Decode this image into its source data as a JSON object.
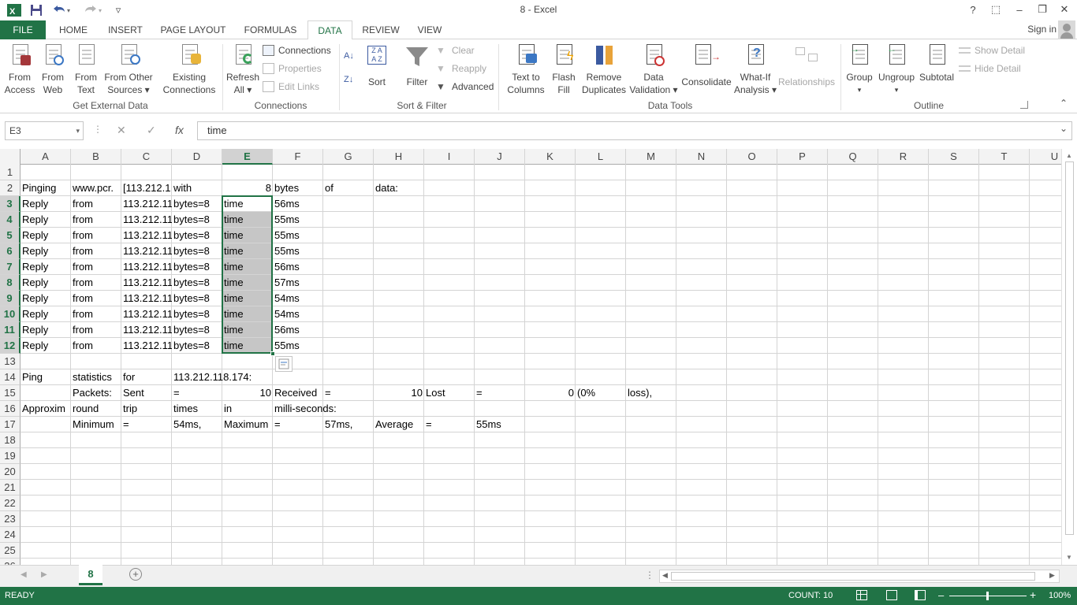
{
  "window": {
    "title": "8 - Excel",
    "help": "?",
    "minimize": "–",
    "restore": "❐",
    "close": "✕",
    "ribbon_display": "⬚"
  },
  "qat": {
    "customize": "▿"
  },
  "tabs": [
    "FILE",
    "HOME",
    "INSERT",
    "PAGE LAYOUT",
    "FORMULAS",
    "DATA",
    "REVIEW",
    "VIEW"
  ],
  "active_tab": "DATA",
  "signin": "Sign in",
  "ribbon": {
    "get_external": {
      "label": "Get External Data",
      "from_access": [
        "From",
        "Access"
      ],
      "from_web": [
        "From",
        "Web"
      ],
      "from_text": [
        "From",
        "Text"
      ],
      "from_other": [
        "From Other",
        "Sources ▾"
      ],
      "existing": [
        "Existing",
        "Connections"
      ]
    },
    "connections": {
      "label": "Connections",
      "refresh": [
        "Refresh",
        "All ▾"
      ],
      "connections": "Connections",
      "properties": "Properties",
      "edit_links": "Edit Links"
    },
    "sort_filter": {
      "label": "Sort & Filter",
      "sort": "Sort",
      "filter": "Filter",
      "clear": "Clear",
      "reapply": "Reapply",
      "advanced": "Advanced"
    },
    "data_tools": {
      "label": "Data Tools",
      "text_to_columns": [
        "Text to",
        "Columns"
      ],
      "flash_fill": [
        "Flash",
        "Fill"
      ],
      "remove_duplicates": [
        "Remove",
        "Duplicates"
      ],
      "data_validation": [
        "Data",
        "Validation ▾"
      ],
      "consolidate": "Consolidate",
      "what_if": [
        "What-If",
        "Analysis ▾"
      ],
      "relationships": "Relationships"
    },
    "outline": {
      "label": "Outline",
      "group": "Group",
      "group_dd": "▾",
      "ungroup": "Ungroup",
      "ungroup_dd": "▾",
      "subtotal": "Subtotal",
      "show_detail": "Show Detail",
      "hide_detail": "Hide Detail"
    }
  },
  "formula_bar": {
    "name_box": "E3",
    "name_box_dd": "▾",
    "cancel": "✕",
    "enter": "✓",
    "fx": "fx",
    "content": "time",
    "expand": "⌄"
  },
  "columns": [
    "A",
    "B",
    "C",
    "D",
    "E",
    "F",
    "G",
    "H",
    "I",
    "J",
    "K",
    "L",
    "M",
    "N",
    "O",
    "P",
    "Q",
    "R",
    "S",
    "T",
    "U"
  ],
  "rows": [
    "1",
    "2",
    "3",
    "4",
    "5",
    "6",
    "7",
    "8",
    "9",
    "10",
    "11",
    "12",
    "13",
    "14",
    "15",
    "16",
    "17",
    "18",
    "19",
    "20",
    "21",
    "22",
    "23",
    "24",
    "25",
    "26"
  ],
  "cells": [
    {
      "r": 2,
      "c": "A",
      "v": "Pinging"
    },
    {
      "r": 2,
      "c": "B",
      "v": "www.pcr."
    },
    {
      "r": 2,
      "c": "C",
      "v": "[113.212.1"
    },
    {
      "r": 2,
      "c": "D",
      "v": "with"
    },
    {
      "r": 2,
      "c": "E",
      "v": "8",
      "num": true
    },
    {
      "r": 2,
      "c": "F",
      "v": "bytes"
    },
    {
      "r": 2,
      "c": "G",
      "v": "of"
    },
    {
      "r": 2,
      "c": "H",
      "v": "data:"
    },
    {
      "r": 3,
      "c": "A",
      "v": "Reply"
    },
    {
      "r": 3,
      "c": "B",
      "v": "from"
    },
    {
      "r": 3,
      "c": "C",
      "v": "113.212.11"
    },
    {
      "r": 3,
      "c": "D",
      "v": "bytes=8"
    },
    {
      "r": 3,
      "c": "E",
      "v": "time"
    },
    {
      "r": 3,
      "c": "F",
      "v": "56ms"
    },
    {
      "r": 4,
      "c": "A",
      "v": "Reply"
    },
    {
      "r": 4,
      "c": "B",
      "v": "from"
    },
    {
      "r": 4,
      "c": "C",
      "v": "113.212.11"
    },
    {
      "r": 4,
      "c": "D",
      "v": "bytes=8"
    },
    {
      "r": 4,
      "c": "E",
      "v": "time"
    },
    {
      "r": 4,
      "c": "F",
      "v": "55ms"
    },
    {
      "r": 5,
      "c": "A",
      "v": "Reply"
    },
    {
      "r": 5,
      "c": "B",
      "v": "from"
    },
    {
      "r": 5,
      "c": "C",
      "v": "113.212.11"
    },
    {
      "r": 5,
      "c": "D",
      "v": "bytes=8"
    },
    {
      "r": 5,
      "c": "E",
      "v": "time"
    },
    {
      "r": 5,
      "c": "F",
      "v": "55ms"
    },
    {
      "r": 6,
      "c": "A",
      "v": "Reply"
    },
    {
      "r": 6,
      "c": "B",
      "v": "from"
    },
    {
      "r": 6,
      "c": "C",
      "v": "113.212.11"
    },
    {
      "r": 6,
      "c": "D",
      "v": "bytes=8"
    },
    {
      "r": 6,
      "c": "E",
      "v": "time"
    },
    {
      "r": 6,
      "c": "F",
      "v": "55ms"
    },
    {
      "r": 7,
      "c": "A",
      "v": "Reply"
    },
    {
      "r": 7,
      "c": "B",
      "v": "from"
    },
    {
      "r": 7,
      "c": "C",
      "v": "113.212.11"
    },
    {
      "r": 7,
      "c": "D",
      "v": "bytes=8"
    },
    {
      "r": 7,
      "c": "E",
      "v": "time"
    },
    {
      "r": 7,
      "c": "F",
      "v": "56ms"
    },
    {
      "r": 8,
      "c": "A",
      "v": "Reply"
    },
    {
      "r": 8,
      "c": "B",
      "v": "from"
    },
    {
      "r": 8,
      "c": "C",
      "v": "113.212.11"
    },
    {
      "r": 8,
      "c": "D",
      "v": "bytes=8"
    },
    {
      "r": 8,
      "c": "E",
      "v": "time"
    },
    {
      "r": 8,
      "c": "F",
      "v": "57ms"
    },
    {
      "r": 9,
      "c": "A",
      "v": "Reply"
    },
    {
      "r": 9,
      "c": "B",
      "v": "from"
    },
    {
      "r": 9,
      "c": "C",
      "v": "113.212.11"
    },
    {
      "r": 9,
      "c": "D",
      "v": "bytes=8"
    },
    {
      "r": 9,
      "c": "E",
      "v": "time"
    },
    {
      "r": 9,
      "c": "F",
      "v": "54ms"
    },
    {
      "r": 10,
      "c": "A",
      "v": "Reply"
    },
    {
      "r": 10,
      "c": "B",
      "v": "from"
    },
    {
      "r": 10,
      "c": "C",
      "v": "113.212.11"
    },
    {
      "r": 10,
      "c": "D",
      "v": "bytes=8"
    },
    {
      "r": 10,
      "c": "E",
      "v": "time"
    },
    {
      "r": 10,
      "c": "F",
      "v": "54ms"
    },
    {
      "r": 11,
      "c": "A",
      "v": "Reply"
    },
    {
      "r": 11,
      "c": "B",
      "v": "from"
    },
    {
      "r": 11,
      "c": "C",
      "v": "113.212.11"
    },
    {
      "r": 11,
      "c": "D",
      "v": "bytes=8"
    },
    {
      "r": 11,
      "c": "E",
      "v": "time"
    },
    {
      "r": 11,
      "c": "F",
      "v": "56ms"
    },
    {
      "r": 12,
      "c": "A",
      "v": "Reply"
    },
    {
      "r": 12,
      "c": "B",
      "v": "from"
    },
    {
      "r": 12,
      "c": "C",
      "v": "113.212.11"
    },
    {
      "r": 12,
      "c": "D",
      "v": "bytes=8"
    },
    {
      "r": 12,
      "c": "E",
      "v": "time"
    },
    {
      "r": 12,
      "c": "F",
      "v": "55ms"
    },
    {
      "r": 14,
      "c": "A",
      "v": "Ping"
    },
    {
      "r": 14,
      "c": "B",
      "v": "statistics"
    },
    {
      "r": 14,
      "c": "C",
      "v": "for"
    },
    {
      "r": 14,
      "c": "D",
      "v": "113.212.118.174:",
      "overflow": true
    },
    {
      "r": 15,
      "c": "B",
      "v": "Packets:"
    },
    {
      "r": 15,
      "c": "C",
      "v": "Sent"
    },
    {
      "r": 15,
      "c": "D",
      "v": "="
    },
    {
      "r": 15,
      "c": "E",
      "v": "10",
      "num": true
    },
    {
      "r": 15,
      "c": "F",
      "v": "Received"
    },
    {
      "r": 15,
      "c": "G",
      "v": "="
    },
    {
      "r": 15,
      "c": "H",
      "v": "10",
      "num": true
    },
    {
      "r": 15,
      "c": "I",
      "v": "Lost"
    },
    {
      "r": 15,
      "c": "J",
      "v": "="
    },
    {
      "r": 15,
      "c": "K",
      "v": "0",
      "num": true
    },
    {
      "r": 15,
      "c": "L",
      "v": "(0%"
    },
    {
      "r": 15,
      "c": "M",
      "v": "loss),"
    },
    {
      "r": 16,
      "c": "A",
      "v": "Approxim"
    },
    {
      "r": 16,
      "c": "B",
      "v": "round"
    },
    {
      "r": 16,
      "c": "C",
      "v": "trip"
    },
    {
      "r": 16,
      "c": "D",
      "v": "times"
    },
    {
      "r": 16,
      "c": "E",
      "v": "in"
    },
    {
      "r": 16,
      "c": "F",
      "v": "milli-seconds:",
      "overflow": true
    },
    {
      "r": 17,
      "c": "B",
      "v": "Minimum"
    },
    {
      "r": 17,
      "c": "C",
      "v": "="
    },
    {
      "r": 17,
      "c": "D",
      "v": "54ms,"
    },
    {
      "r": 17,
      "c": "E",
      "v": "Maximum"
    },
    {
      "r": 17,
      "c": "F",
      "v": "="
    },
    {
      "r": 17,
      "c": "G",
      "v": "57ms,"
    },
    {
      "r": 17,
      "c": "H",
      "v": "Average"
    },
    {
      "r": 17,
      "c": "I",
      "v": "="
    },
    {
      "r": 17,
      "c": "J",
      "v": "55ms"
    }
  ],
  "selection": {
    "name": "E3:E12",
    "active": "E3"
  },
  "sheet_tabs": [
    "8"
  ],
  "add_sheet": "+",
  "status": {
    "ready": "READY",
    "count": "COUNT: 10",
    "zoom": "100%",
    "zoom_minus": "–",
    "zoom_plus": "+"
  },
  "colors": {
    "accent": "#217346",
    "selection_fill": "#c6c6c6"
  }
}
